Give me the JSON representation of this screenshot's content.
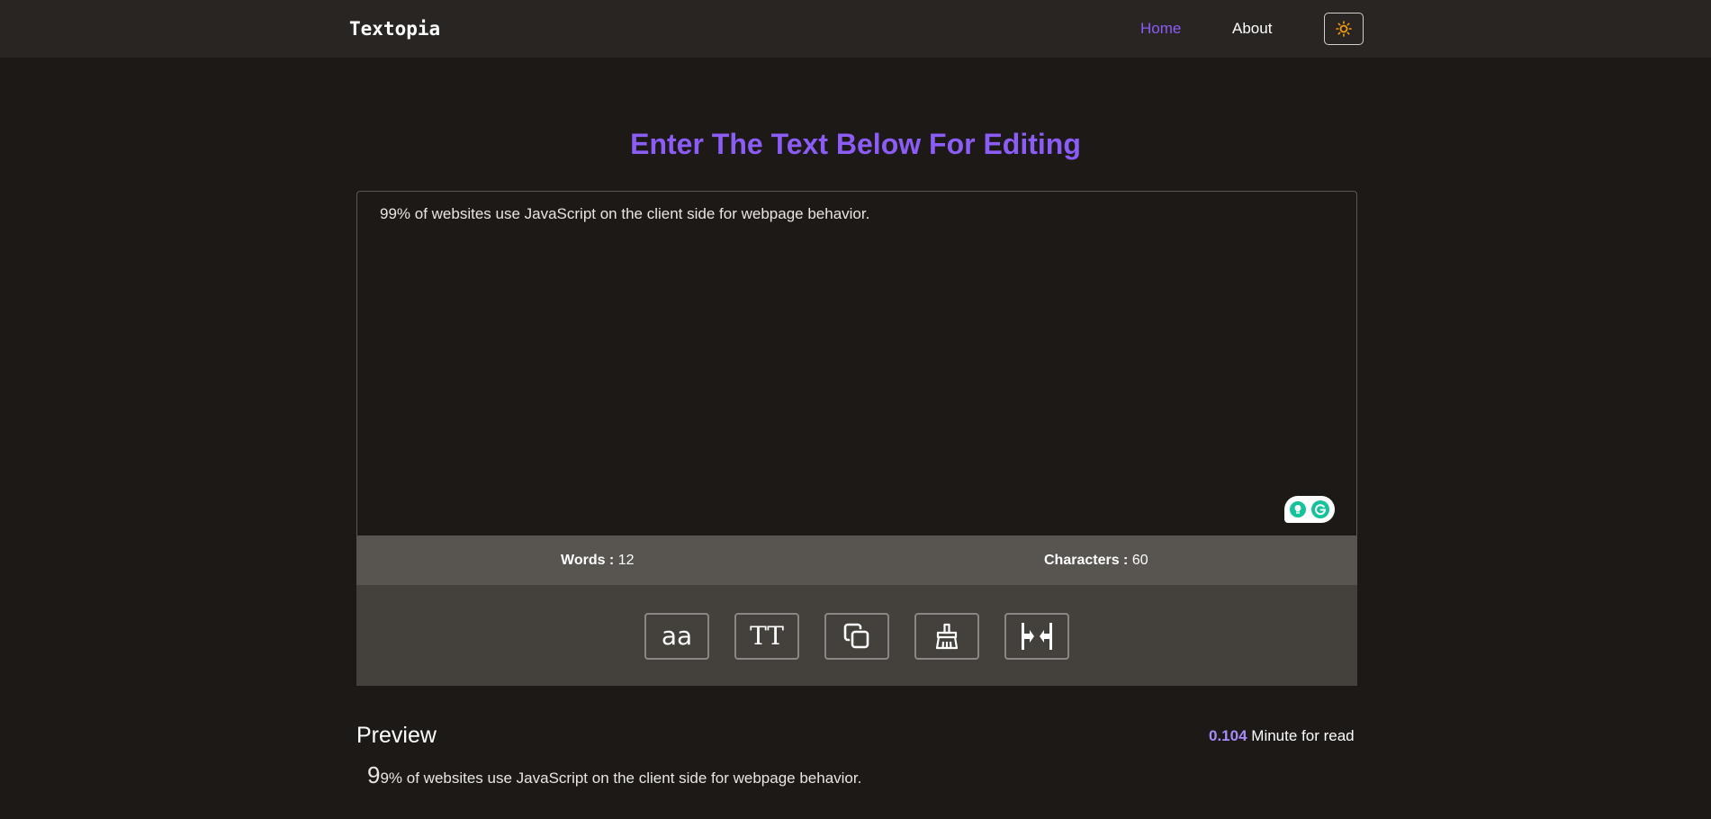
{
  "nav": {
    "brand": "Textopia",
    "links": [
      {
        "label": "Home",
        "active": true
      },
      {
        "label": "About",
        "active": false
      }
    ],
    "theme_icon": "sun-icon"
  },
  "colors": {
    "accent": "#8b5cf6",
    "background": "#1d1917",
    "navbar": "#282523",
    "stats_bar": "#585450",
    "toolbar": "#44403c",
    "read_time_number": "#a78bfa",
    "sun": "#f59e0b",
    "grammarly_green": "#15c39a"
  },
  "editor": {
    "heading": "Enter The Text Below For Editing",
    "text": "99% of websites use JavaScript on the client side for webpage behavior."
  },
  "stats": {
    "words_label": "Words :",
    "words_value": "12",
    "characters_label": "Characters :",
    "characters_value": "60"
  },
  "toolbar": {
    "buttons": [
      {
        "name": "lowercase",
        "label": "aa",
        "icon": "lowercase-icon"
      },
      {
        "name": "uppercase",
        "label": "TT",
        "icon": "uppercase-icon"
      },
      {
        "name": "copy",
        "label": "",
        "icon": "copy-icon"
      },
      {
        "name": "clear",
        "label": "",
        "icon": "broom-icon"
      },
      {
        "name": "remove-spaces",
        "label": "",
        "icon": "remove-spaces-icon"
      }
    ]
  },
  "preview": {
    "title": "Preview",
    "read_time_value": "0.104",
    "read_time_suffix": "Minute for read",
    "first_char": "9",
    "rest_text": "9% of websites use JavaScript on the client side for webpage behavior."
  }
}
